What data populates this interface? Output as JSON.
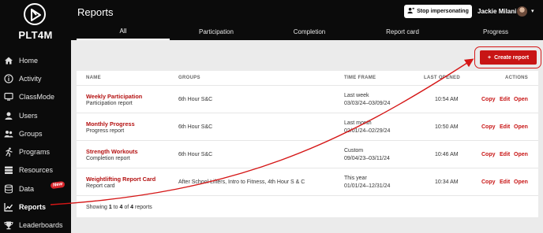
{
  "app": {
    "logo_text": "PLT4M"
  },
  "sidebar": {
    "items": [
      {
        "label": "Home",
        "icon": "home-icon"
      },
      {
        "label": "Activity",
        "icon": "info-icon"
      },
      {
        "label": "ClassMode",
        "icon": "monitor-icon"
      },
      {
        "label": "Users",
        "icon": "user-icon"
      },
      {
        "label": "Groups",
        "icon": "groups-icon"
      },
      {
        "label": "Programs",
        "icon": "runner-icon"
      },
      {
        "label": "Resources",
        "icon": "resources-icon"
      },
      {
        "label": "Data",
        "icon": "database-icon",
        "badge": "New"
      },
      {
        "label": "Reports",
        "icon": "chart-icon",
        "active": true
      },
      {
        "label": "Leaderboards",
        "icon": "trophy-icon"
      }
    ]
  },
  "header": {
    "title": "Reports",
    "stop_impersonating": "Stop impersonating",
    "user_name": "Jackie Milani"
  },
  "tabs": [
    "All",
    "Participation",
    "Completion",
    "Report card",
    "Progress"
  ],
  "create_report": "Create report",
  "table": {
    "headers": {
      "name": "NAME",
      "groups": "GROUPS",
      "time_frame": "TIME FRAME",
      "last_opened": "LAST OPENED",
      "actions": "ACTIONS"
    },
    "actions": {
      "copy": "Copy",
      "edit": "Edit",
      "open": "Open"
    },
    "rows": [
      {
        "title": "Weekly Participation",
        "subtitle": "Participation report",
        "groups": "6th Hour S&C",
        "tf_label": "Last week",
        "tf_range": "03/03/24–03/09/24",
        "last_opened": "10:54 AM"
      },
      {
        "title": "Monthly Progress",
        "subtitle": "Progress report",
        "groups": "6th Hour S&C",
        "tf_label": "Last month",
        "tf_range": "02/01/24–02/29/24",
        "last_opened": "10:50 AM"
      },
      {
        "title": "Strength Workouts",
        "subtitle": "Completion report",
        "groups": "6th Hour S&C",
        "tf_label": "Custom",
        "tf_range": "09/04/23–03/11/24",
        "last_opened": "10:46 AM"
      },
      {
        "title": "Weightlifting Report Card",
        "subtitle": "Report card",
        "groups": "After School Lifters, Intro to Fitness, 4th Hour S & C",
        "tf_label": "This year",
        "tf_range": "01/01/24–12/31/24",
        "last_opened": "10:34 AM"
      }
    ]
  },
  "footer": {
    "prefix": "Showing",
    "from": "1",
    "to_word": "to",
    "to": "4",
    "of_word": "of",
    "total": "4",
    "suffix": "reports"
  },
  "colors": {
    "accent": "#c81515",
    "sidebar_bg": "#0b0b0b",
    "page_bg": "#ebebeb"
  }
}
